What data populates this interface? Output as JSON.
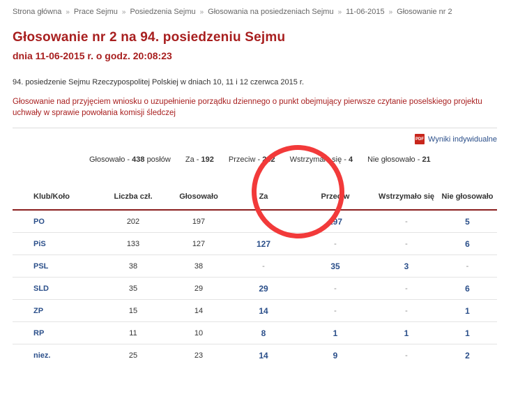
{
  "breadcrumb": {
    "items": [
      "Strona główna",
      "Prace Sejmu",
      "Posiedzenia Sejmu",
      "Głosowania na posiedzeniach Sejmu",
      "11-06-2015",
      "Głosowanie nr 2"
    ],
    "separator": "»"
  },
  "title": "Głosowanie nr 2 na 94. posiedzeniu Sejmu",
  "subtitle": "dnia 11-06-2015 r. o godz. 20:08:23",
  "info": "94. posiedzenie Sejmu Rzeczypospolitej Polskiej w dniach 10, 11 i 12 czerwca 2015 r.",
  "description": "Głosowanie nad przyjęciem wniosku o uzupełnienie porządku dziennego o punkt obejmujący pierwsze czytanie poselskiego projektu uchwały w sprawie powołania komisji śledczej",
  "pdf": {
    "label": "Wyniki indywidualne",
    "icon": "pdf-icon",
    "icon_text": "PDF"
  },
  "summary": {
    "glosowalo_label": "Głosowało -",
    "glosowalo_value": "438",
    "poslow": "posłów",
    "za_label": "Za -",
    "za_value": "192",
    "przeciw_label": "Przeciw -",
    "przeciw_value": "242",
    "wstrzymalo_label": "Wstrzymało się -",
    "wstrzymalo_value": "4",
    "nie_label": "Nie głosowało -",
    "nie_value": "21"
  },
  "table": {
    "headers": [
      "Klub/Koło",
      "Liczba czł.",
      "Głosowało",
      "Za",
      "Przeciw",
      "Wstrzymało się",
      "Nie głosowało"
    ],
    "rows": [
      [
        "PO",
        "202",
        "197",
        "-",
        "197",
        "-",
        "5"
      ],
      [
        "PiS",
        "133",
        "127",
        "127",
        "-",
        "-",
        "6"
      ],
      [
        "PSL",
        "38",
        "38",
        "-",
        "35",
        "3",
        "-"
      ],
      [
        "SLD",
        "35",
        "29",
        "29",
        "-",
        "-",
        "6"
      ],
      [
        "ZP",
        "15",
        "14",
        "14",
        "-",
        "-",
        "1"
      ],
      [
        "RP",
        "11",
        "10",
        "8",
        "1",
        "1",
        "1"
      ],
      [
        "niez.",
        "25",
        "23",
        "14",
        "9",
        "-",
        "2"
      ]
    ]
  },
  "colors": {
    "accent": "#a81f1f",
    "link": "#2b4f8a",
    "annotation": "#f23a3a"
  }
}
